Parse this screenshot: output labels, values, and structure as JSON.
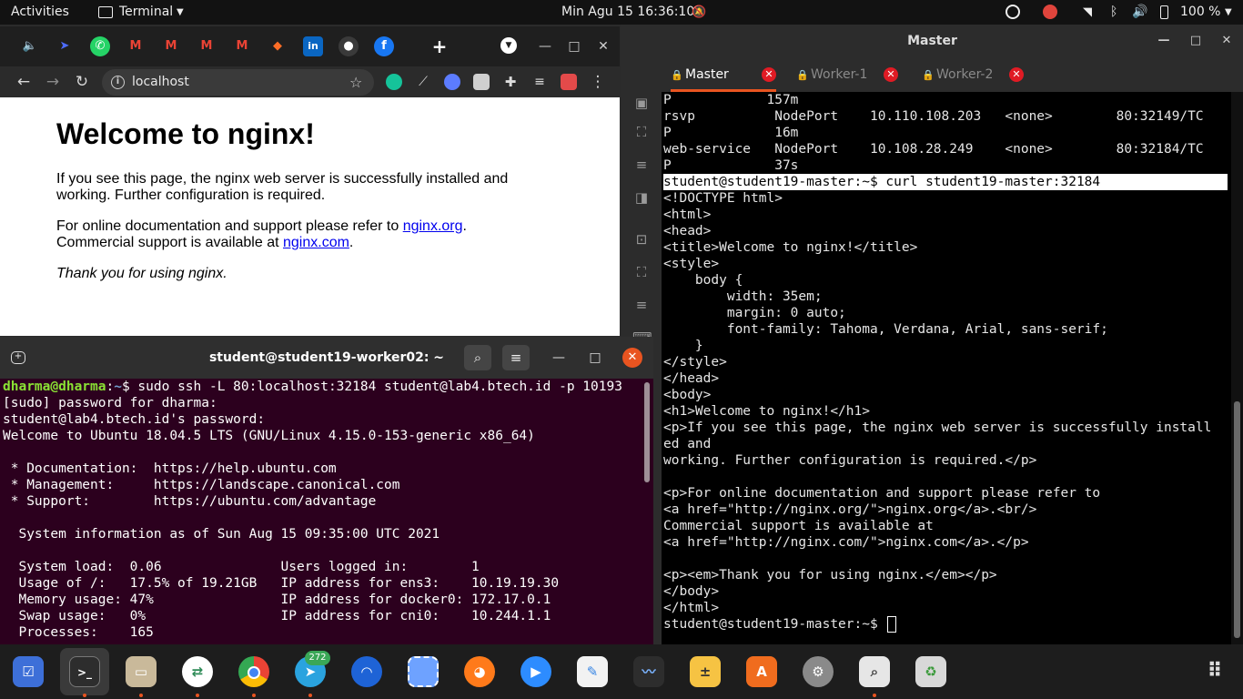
{
  "topbar": {
    "activities": "Activities",
    "app_name": "Terminal",
    "clock": "Min Agu 15  16:36:10",
    "battery": "100 %"
  },
  "chrome": {
    "url": "localhost",
    "page": {
      "heading": "Welcome to nginx!",
      "p1_line1": "If you see this page, the nginx web server is successfully installed and",
      "p1_line2": "working. Further configuration is required.",
      "p2_text1": "For online documentation and support please refer to ",
      "p2_link1": "nginx.org",
      "p2_text2": ".",
      "p2_text3": "Commercial support is available at ",
      "p2_link2": "nginx.com",
      "p2_text4": ".",
      "thanks": "Thank you for using nginx."
    }
  },
  "master": {
    "title": "Master",
    "tabs": [
      {
        "label": "Master"
      },
      {
        "label": "Worker-1"
      },
      {
        "label": "Worker-2"
      }
    ],
    "lines": [
      "P            157m",
      "rsvp          NodePort    10.110.108.203   <none>        80:32149/TC",
      "P             16m",
      "web-service   NodePort    10.108.28.249    <none>        80:32184/TC",
      "P             37s",
      "student@student19-master:~$ curl student19-master:32184",
      "<!DOCTYPE html>",
      "<html>",
      "<head>",
      "<title>Welcome to nginx!</title>",
      "<style>",
      "    body {",
      "        width: 35em;",
      "        margin: 0 auto;",
      "        font-family: Tahoma, Verdana, Arial, sans-serif;",
      "    }",
      "</style>",
      "</head>",
      "<body>",
      "<h1>Welcome to nginx!</h1>",
      "<p>If you see this page, the nginx web server is successfully install",
      "ed and",
      "working. Further configuration is required.</p>",
      "",
      "<p>For online documentation and support please refer to",
      "<a href=\"http://nginx.org/\">nginx.org</a>.<br/>",
      "Commercial support is available at",
      "<a href=\"http://nginx.com/\">nginx.com</a>.</p>",
      "",
      "<p><em>Thank you for using nginx.</em></p>",
      "</body>",
      "</html>",
      "student@student19-master:~$ "
    ]
  },
  "worker": {
    "title": "student@student19-worker02: ~",
    "prompt_user": "dharma@dharma",
    "prompt_path": "~",
    "prompt_command": "$ sudo ssh -L 80:localhost:32184 student@lab4.btech.id -p 10193",
    "lines": [
      "[sudo] password for dharma:",
      "student@lab4.btech.id's password:",
      "Welcome to Ubuntu 18.04.5 LTS (GNU/Linux 4.15.0-153-generic x86_64)",
      "",
      " * Documentation:  https://help.ubuntu.com",
      " * Management:     https://landscape.canonical.com",
      " * Support:        https://ubuntu.com/advantage",
      "",
      "  System information as of Sun Aug 15 09:35:00 UTC 2021",
      "",
      "  System load:  0.06               Users logged in:        1",
      "  Usage of /:   17.5% of 19.21GB   IP address for ens3:    10.19.19.30",
      "  Memory usage: 47%                IP address for docker0: 172.17.0.1",
      "  Swap usage:   0%                 IP address for cni0:    10.244.1.1",
      "  Processes:    165"
    ]
  },
  "dock": {
    "telegram_badge": "272",
    "items": [
      "tasks-icon",
      "terminal-icon",
      "files-icon",
      "remote-icon",
      "chrome-icon",
      "telegram-icon",
      "browser-icon",
      "screenshot-icon",
      "firefox-icon",
      "zoom-icon",
      "text-editor-icon",
      "system-monitor-icon",
      "calculator-icon",
      "software-center-icon",
      "settings-icon",
      "image-viewer-icon",
      "trash-icon",
      "show-apps-icon"
    ]
  },
  "colors": {
    "master_active_tab": "#e95420",
    "close_red": "#e01b24",
    "worker_bg": "#2c001e",
    "prompt_green": "#8ae234",
    "prompt_blue": "#729fcf"
  }
}
